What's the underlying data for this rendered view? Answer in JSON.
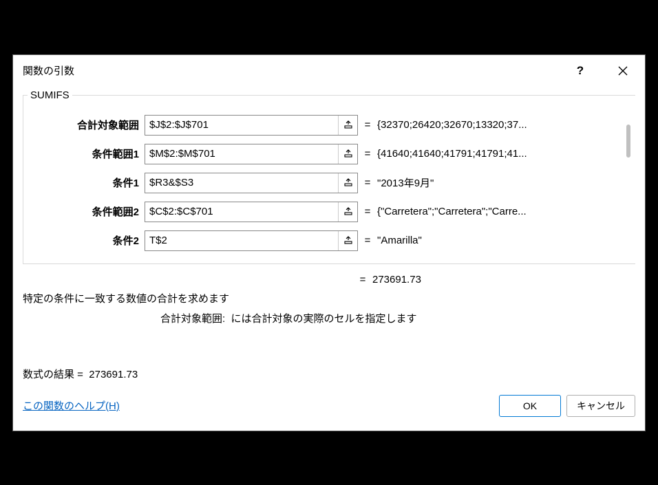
{
  "dialog": {
    "title": "関数の引数"
  },
  "function": {
    "name": "SUMIFS",
    "args": [
      {
        "label": "合計対象範囲",
        "value": "$J$2:$J$701",
        "preview": "{32370;26420;32670;13320;37..."
      },
      {
        "label": "条件範囲1",
        "value": "$M$2:$M$701",
        "preview": "{41640;41640;41791;41791;41..."
      },
      {
        "label": "条件1",
        "value": "$R3&$S3",
        "preview": "\"2013年9月\""
      },
      {
        "label": "条件範囲2",
        "value": "$C$2:$C$701",
        "preview": "{\"Carretera\";\"Carretera\";\"Carre..."
      },
      {
        "label": "条件2",
        "value": "T$2",
        "preview": "\"Amarilla\""
      }
    ],
    "overall_result": "273691.73",
    "description": "特定の条件に一致する数値の合計を求めます",
    "arg_desc_label": "合計対象範囲:",
    "arg_desc_text": "には合計対象の実際のセルを指定します"
  },
  "labels": {
    "formula_result_prefix": "数式の結果 = ",
    "formula_result_value": "273691.73",
    "help_link": "この関数のヘルプ(H)",
    "ok": "OK",
    "cancel": "キャンセル",
    "eq": "="
  }
}
